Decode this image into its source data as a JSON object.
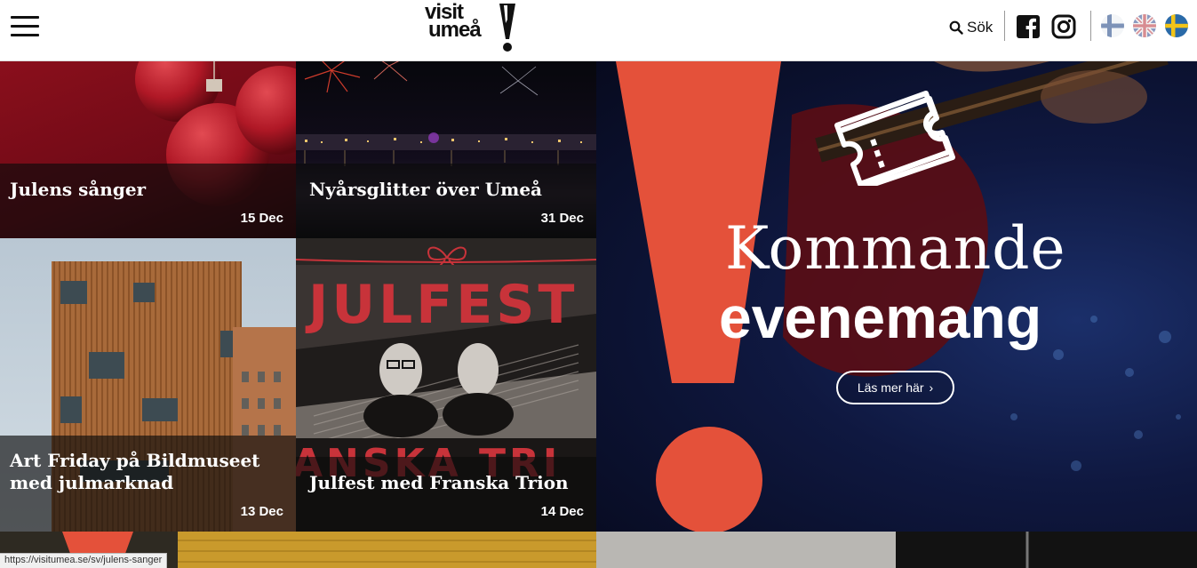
{
  "header": {
    "menu_icon": "hamburger-menu-icon",
    "logo": {
      "line1": "visit",
      "line2": "umeå"
    },
    "search": {
      "icon": "search-icon",
      "label": "Sök"
    },
    "social": [
      {
        "name": "facebook-icon"
      },
      {
        "name": "instagram-icon"
      }
    ],
    "languages": [
      {
        "name": "flag-finland-icon"
      },
      {
        "name": "flag-uk-icon"
      },
      {
        "name": "flag-sweden-icon"
      }
    ]
  },
  "events": [
    {
      "title": "Julens sånger",
      "date": "15 Dec"
    },
    {
      "title": "Nyårsglitter över Umeå",
      "date": "31 Dec"
    },
    {
      "title": "Art Friday på Bildmuseet med julmarknad",
      "date": "13 Dec"
    },
    {
      "title": "Julfest med Franska Trion",
      "date": "14 Dec"
    }
  ],
  "poster": {
    "headline": "JULFEST",
    "footer": "ANSKA TRI"
  },
  "hero": {
    "title_light": "Kommande",
    "title_bold": "evenemang",
    "button_label": "Läs mer här",
    "button_icon": "chevron-right-icon",
    "ticket_icon": "ticket-icon"
  },
  "colors": {
    "accent": "#e4513a",
    "header_bg": "#ffffff",
    "caption_bg": "#0a0a0a"
  },
  "statusbar": {
    "url": "https://visitumea.se/sv/julens-sanger"
  }
}
